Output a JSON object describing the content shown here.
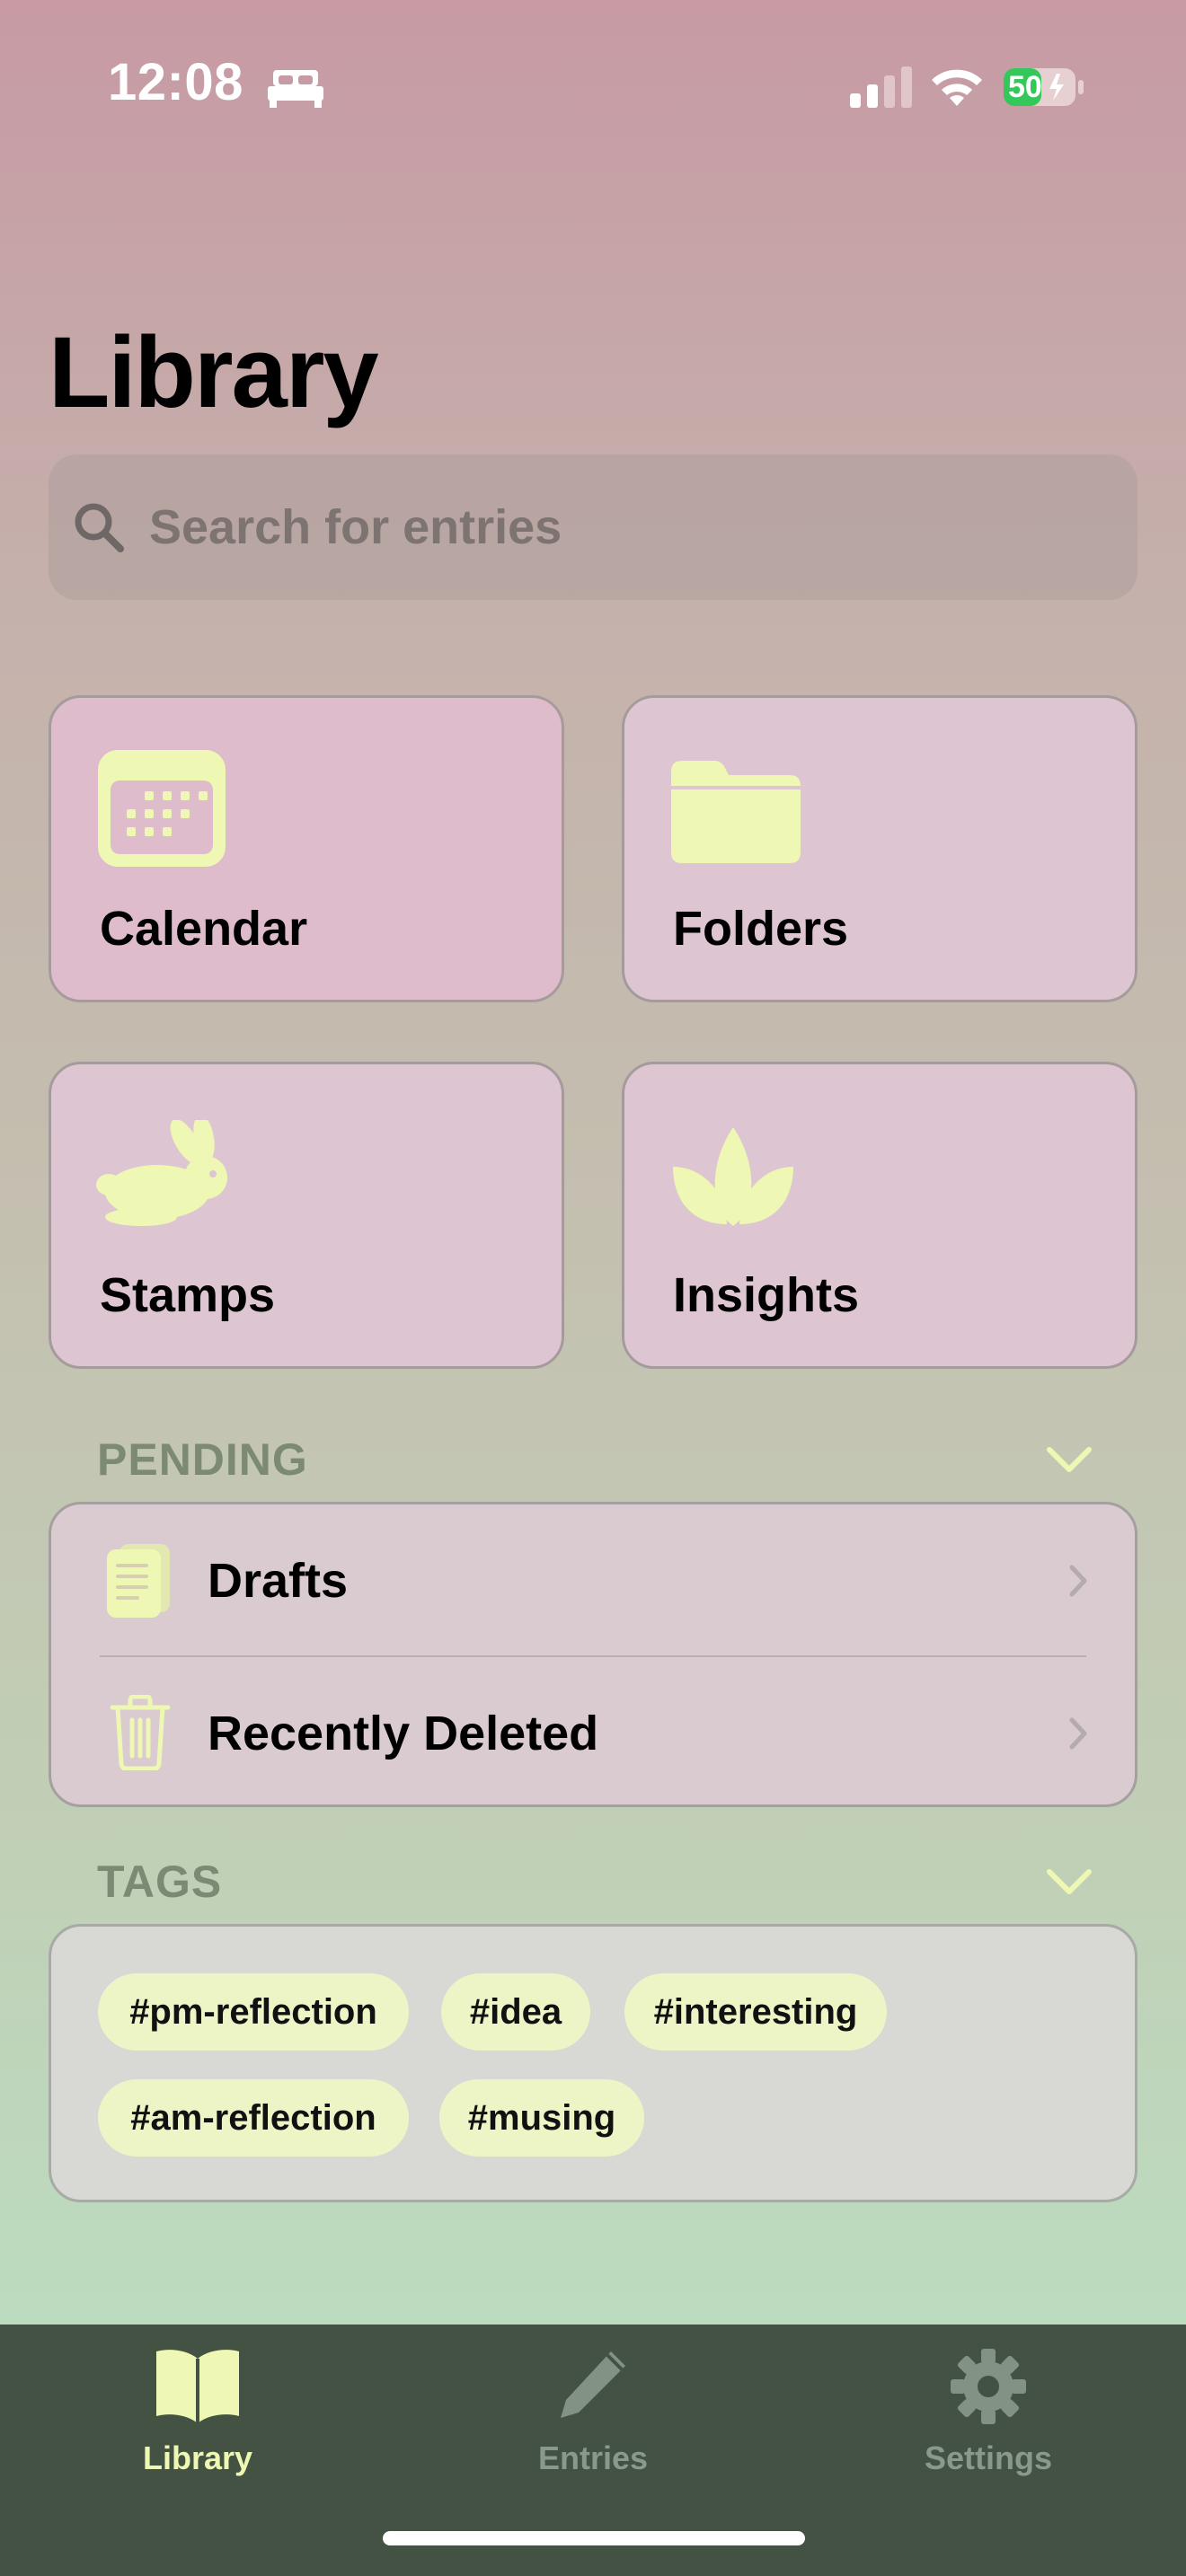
{
  "status": {
    "time": "12:08",
    "battery": "50"
  },
  "page": {
    "title": "Library"
  },
  "search": {
    "placeholder": "Search for entries"
  },
  "cards": [
    {
      "label": "Calendar",
      "icon": "calendar-icon"
    },
    {
      "label": "Folders",
      "icon": "folder-icon"
    },
    {
      "label": "Stamps",
      "icon": "rabbit-icon"
    },
    {
      "label": "Insights",
      "icon": "leaves-icon"
    }
  ],
  "pending": {
    "header": "PENDING",
    "items": [
      {
        "label": "Drafts",
        "icon": "document-icon"
      },
      {
        "label": "Recently Deleted",
        "icon": "trash-icon"
      }
    ]
  },
  "tags": {
    "header": "TAGS",
    "items": [
      "#pm-reflection",
      "#idea",
      "#interesting",
      "#am-reflection",
      "#musing"
    ]
  },
  "tabbar": {
    "items": [
      {
        "label": "Library",
        "icon": "book-icon",
        "active": true
      },
      {
        "label": "Entries",
        "icon": "pencil-icon",
        "active": false
      },
      {
        "label": "Settings",
        "icon": "gear-icon",
        "active": false
      }
    ]
  },
  "colors": {
    "accent": "#eef7b3",
    "tabbar": "#435243",
    "card": "#dfbccb"
  }
}
